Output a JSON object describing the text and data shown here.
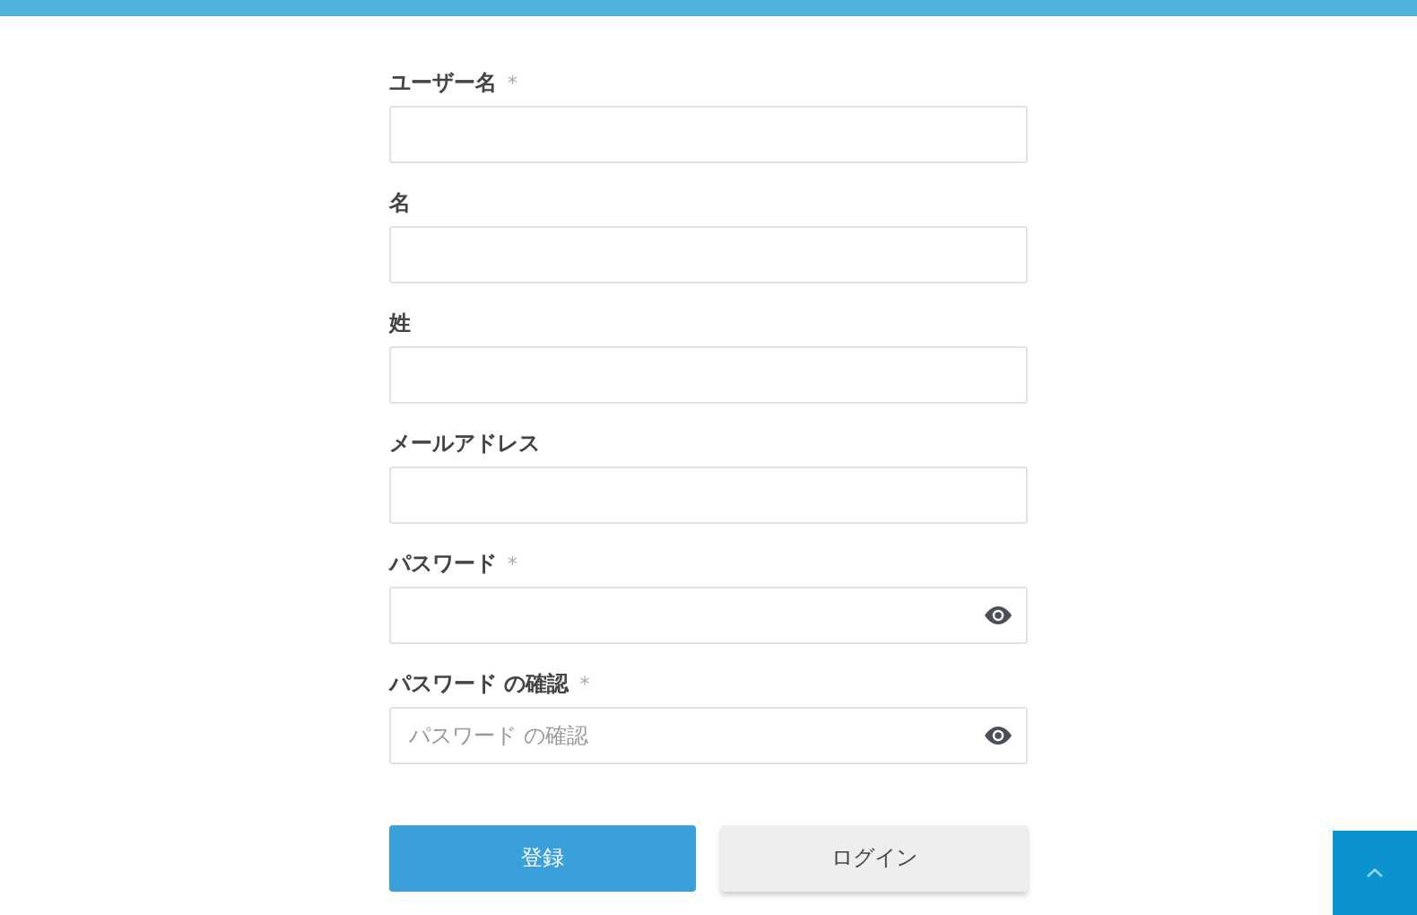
{
  "fields": [
    {
      "label": "ユーザー名",
      "required": true,
      "kind": "text"
    },
    {
      "label": "名",
      "required": false,
      "kind": "text"
    },
    {
      "label": "姓",
      "required": false,
      "kind": "text"
    },
    {
      "label": "メールアドレス",
      "required": false,
      "kind": "text"
    },
    {
      "label": "パスワード",
      "required": true,
      "kind": "password"
    },
    {
      "label": "パスワード の確認",
      "required": true,
      "kind": "password",
      "placeholder": "パスワード の確認"
    }
  ],
  "required_mark": "*",
  "buttons": [
    {
      "label": "登録",
      "kind": "primary"
    },
    {
      "label": "ログイン",
      "kind": "secondary"
    }
  ]
}
